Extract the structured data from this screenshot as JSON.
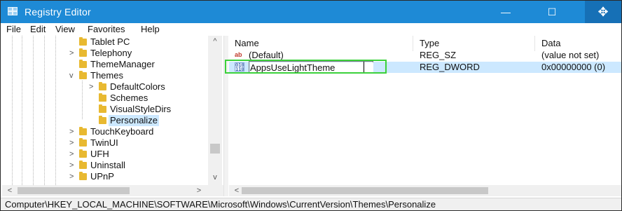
{
  "window": {
    "title": "Registry Editor",
    "icon": "registry-icon",
    "controls": {
      "minimize": "—",
      "maximize": "☐",
      "move": "✥"
    },
    "accent_color": "#1e8ad6"
  },
  "menu": [
    "File",
    "Edit",
    "View",
    "Favorites",
    "Help"
  ],
  "tree": {
    "items": [
      {
        "label": "Tablet PC",
        "expander": ""
      },
      {
        "label": "Telephony",
        "expander": ">"
      },
      {
        "label": "ThemeManager",
        "expander": ""
      },
      {
        "label": "Themes",
        "expander": "v"
      },
      {
        "label": "DefaultColors",
        "expander": ">"
      },
      {
        "label": "Schemes",
        "expander": ""
      },
      {
        "label": "VisualStyleDirs",
        "expander": ""
      },
      {
        "label": "Personalize",
        "expander": "",
        "selected": true
      },
      {
        "label": "TouchKeyboard",
        "expander": ">"
      },
      {
        "label": "TwinUI",
        "expander": ">"
      },
      {
        "label": "UFH",
        "expander": ">"
      },
      {
        "label": "Uninstall",
        "expander": ">"
      },
      {
        "label": "UPnP",
        "expander": ">"
      }
    ],
    "scroll_up": "^",
    "scroll_down": "v",
    "scroll_left": "<",
    "scroll_right": ">"
  },
  "list": {
    "columns": [
      "Name",
      "Type",
      "Data"
    ],
    "rows": [
      {
        "icon": "string-value-icon",
        "icon_text": "ab",
        "name": "(Default)",
        "type": "REG_SZ",
        "data": "(value not set)"
      },
      {
        "icon": "binary-value-icon",
        "icon_text": "010 110",
        "name": "AppsUseLightTheme",
        "type": "REG_DWORD",
        "data": "0x00000000 (0)",
        "selected": true,
        "editing": true
      }
    ],
    "scroll_left": "<",
    "highlight_color": "#3bd13b"
  },
  "status_bar": {
    "path": "Computer\\HKEY_LOCAL_MACHINE\\SOFTWARE\\Microsoft\\Windows\\CurrentVersion\\Themes\\Personalize"
  }
}
